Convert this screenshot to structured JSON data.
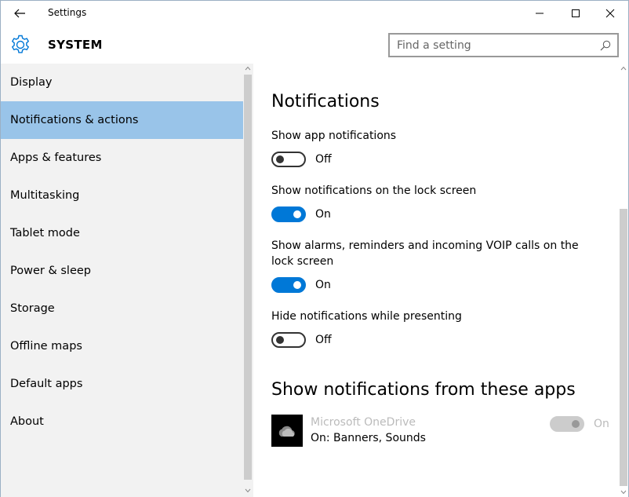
{
  "window": {
    "title": "Settings"
  },
  "header": {
    "section_title": "SYSTEM",
    "search_placeholder": "Find a setting"
  },
  "sidebar": {
    "items": [
      {
        "label": "Display",
        "selected": false
      },
      {
        "label": "Notifications & actions",
        "selected": true
      },
      {
        "label": "Apps & features",
        "selected": false
      },
      {
        "label": "Multitasking",
        "selected": false
      },
      {
        "label": "Tablet mode",
        "selected": false
      },
      {
        "label": "Power & sleep",
        "selected": false
      },
      {
        "label": "Storage",
        "selected": false
      },
      {
        "label": "Offline maps",
        "selected": false
      },
      {
        "label": "Default apps",
        "selected": false
      },
      {
        "label": "About",
        "selected": false
      }
    ]
  },
  "main": {
    "heading": "Notifications",
    "settings": [
      {
        "label": "Show app notifications",
        "state": "Off"
      },
      {
        "label": "Show notifications on the lock screen",
        "state": "On"
      },
      {
        "label": "Show alarms, reminders and incoming VOIP calls on the lock screen",
        "state": "On"
      },
      {
        "label": "Hide notifications while presenting",
        "state": "Off"
      }
    ],
    "apps_heading": "Show notifications from these apps",
    "apps": [
      {
        "name": "Microsoft OneDrive",
        "subtitle": "On: Banners, Sounds",
        "state": "On",
        "disabled": true
      }
    ]
  },
  "colors": {
    "accent": "#0078d7",
    "selected_nav": "#99c4e9",
    "sidebar_bg": "#f2f2f2"
  }
}
